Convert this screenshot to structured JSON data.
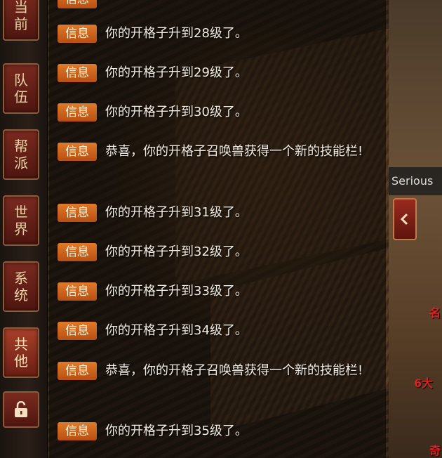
{
  "tabs": [
    {
      "label_top": "当",
      "label_bottom": "前"
    },
    {
      "label_top": "队",
      "label_bottom": "伍"
    },
    {
      "label_top": "帮",
      "label_bottom": "派"
    },
    {
      "label_top": "世",
      "label_bottom": "界"
    },
    {
      "label_top": "系",
      "label_bottom": "统"
    },
    {
      "label_top": "共",
      "label_bottom": "他"
    }
  ],
  "active_tab": "其他",
  "chat": {
    "messages": [
      {
        "tag": "信息",
        "text": "你的开格子升到28级了。"
      },
      {
        "tag": "信息",
        "text": "你的开格子升到29级了。"
      },
      {
        "tag": "信息",
        "text": "你的开格子升到30级了。"
      },
      {
        "tag": "信息",
        "text": "恭喜，你的开格子召唤兽获得一个新的技能栏!"
      },
      {
        "tag": "信息",
        "text": "你的开格子升到31级了。"
      },
      {
        "tag": "信息",
        "text": "你的开格子升到32级了。"
      },
      {
        "tag": "信息",
        "text": "你的开格子升到33级了。"
      },
      {
        "tag": "信息",
        "text": "你的开格子升到34级了。"
      },
      {
        "tag": "信息",
        "text": "恭喜，你的开格子召唤兽获得一个新的技能栏!"
      },
      {
        "tag": "信息",
        "text": "你的开格子升到35级了。"
      }
    ]
  },
  "player_name_partial": "Serious",
  "scene_text": {
    "partial_a": "名",
    "partial_b": "6大",
    "partial_c": "奇"
  },
  "colors": {
    "tag_bg": "#d0651e",
    "tab_bg": "#6a2016",
    "text": "#f2ece2"
  },
  "icons": {
    "lock": "unlock-icon",
    "collapse": "chevron-left-icon"
  }
}
